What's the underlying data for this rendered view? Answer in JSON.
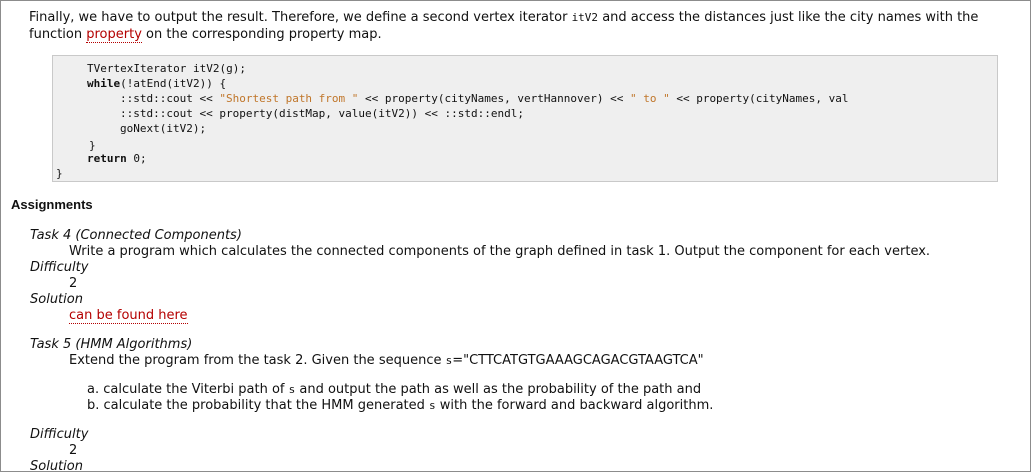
{
  "intro": {
    "text1": "Finally, we have to output the result. Therefore, we define a second vertex iterator ",
    "code_itv2": "itV2",
    "text2": " and access the distances just like the city names with the",
    "text3": "function ",
    "link_property": "property",
    "text4": " on the corresponding property map."
  },
  "code": {
    "l1": "TVertexIterator itV2(g);",
    "l2_kw": "while",
    "l2_rest": "(!atEnd(itV2)) {",
    "l3_a": "::std::cout << ",
    "l3_s1": "\"Shortest path from \"",
    "l3_b": " << property(cityNames, vertHannover) << ",
    "l3_s2": "\" to \"",
    "l3_c": " << property(cityNames, val",
    "l4": "::std::cout << property(distMap, value(itV2)) << ::std::endl;",
    "l5": "goNext(itV2);",
    "l6": "}",
    "l7_kw": "return",
    "l7_rest": " 0;",
    "l8": "}"
  },
  "assignments": {
    "heading": "Assignments",
    "task4": {
      "title": "Task 4 (Connected Components)",
      "description": "Write a program which calculates the connected components of the graph defined in task 1. Output the component for each vertex.",
      "difficulty_label": "Difficulty",
      "difficulty_value": "2",
      "solution_label": "Solution",
      "solution_link": "can be found here"
    },
    "task5": {
      "title": "Task 5 (HMM Algorithms)",
      "desc_a": "Extend the program from the task 2. Given the sequence ",
      "desc_code": "s",
      "desc_b": "=\"CTTCATGTGAAAGCAGACGTAAGTCA\"",
      "item_a_1": "a.  calculate the Viterbi path of ",
      "item_a_code": "s",
      "item_a_2": " and output the path as well as the probability of the path and",
      "item_b_1": "b.  calculate the probability that the HMM generated ",
      "item_b_code": "s",
      "item_b_2": " with the forward and backward algorithm.",
      "difficulty_label": "Difficulty",
      "difficulty_value": "2",
      "solution_label": "Solution"
    }
  }
}
